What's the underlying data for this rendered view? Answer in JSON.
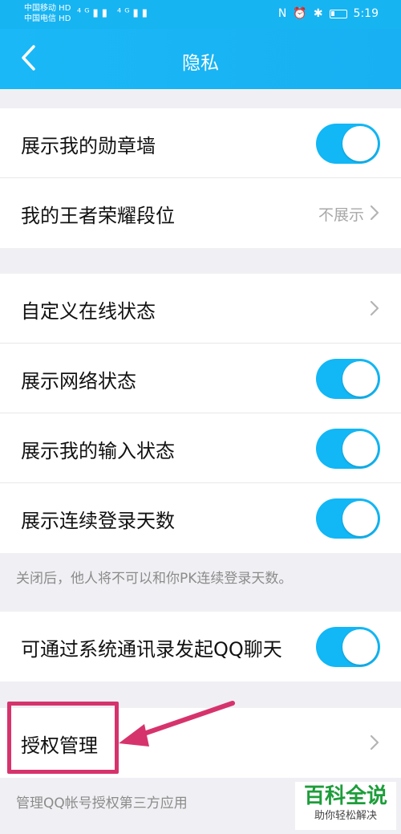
{
  "status_bar": {
    "carrier1": "中国移动 HD",
    "carrier2": "中国电信 HD",
    "signal": "⁴ᴳ▮▮ ⁴ᴳ▮▮",
    "time": "5:19"
  },
  "nav": {
    "title": "隐私"
  },
  "group1": [
    {
      "label": "展示我的勋章墙",
      "type": "toggle",
      "on": true
    },
    {
      "label": "我的王者荣耀段位",
      "type": "link",
      "value": "不展示"
    }
  ],
  "group2": [
    {
      "label": "自定义在线状态",
      "type": "link"
    },
    {
      "label": "展示网络状态",
      "type": "toggle",
      "on": true
    },
    {
      "label": "展示我的输入状态",
      "type": "toggle",
      "on": true
    },
    {
      "label": "展示连续登录天数",
      "type": "toggle",
      "on": true
    }
  ],
  "note1": "关闭后，他人将不可以和你PK连续登录天数。",
  "group3": [
    {
      "label": "可通过系统通讯录发起QQ聊天",
      "type": "toggle",
      "on": true
    }
  ],
  "group4": [
    {
      "label": "授权管理",
      "type": "link"
    }
  ],
  "note2": "管理QQ帐号授权第三方应用",
  "watermark": {
    "main": "百科全说",
    "sub": "助你轻松解决"
  },
  "colors": {
    "accent": "#12b7f5",
    "highlight": "#d6336c"
  }
}
